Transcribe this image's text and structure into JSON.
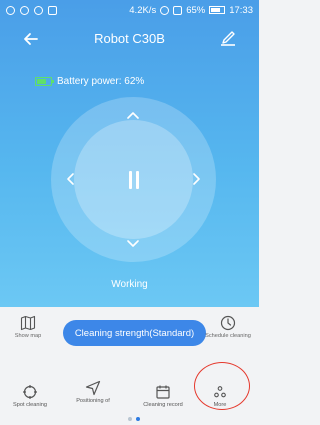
{
  "statusbar": {
    "network_speed": "4.2K/s",
    "battery": "65%",
    "time": "17:33"
  },
  "header": {
    "title": "Robot C30B"
  },
  "battery_label": "Battery power: 62%",
  "status": "Working",
  "actions": {
    "show_map": "Show map",
    "cleaning_strength": "Cleaning strength(Standard)",
    "schedule_cleaning": "Schedule cleaning"
  },
  "bottom_nav": {
    "spot_cleaning": "Spot cleaning",
    "positioning": "Positioning of",
    "cleaning_record": "Cleaning record",
    "more": "More"
  },
  "colors": {
    "header_gradient_top": "#4a9ee8",
    "header_gradient_bottom": "#6cc8f4",
    "accent_button": "#3d87e8",
    "battery_green": "#5fe06a",
    "highlight_circle": "#e5392d"
  },
  "pager": {
    "pages": 2,
    "active_page": 2
  }
}
